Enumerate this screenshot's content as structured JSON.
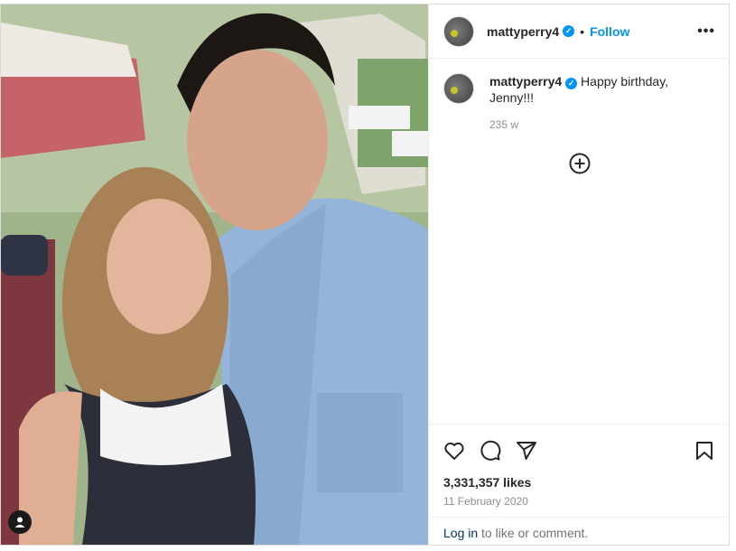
{
  "post": {
    "username": "mattyperry4",
    "verified_mark": "✓",
    "separator": "•",
    "follow_label": "Follow",
    "more_label": "•••",
    "caption_username": "mattyperry4",
    "caption_text": "Happy birthday, Jenny!!!",
    "caption_age": "235 w",
    "likes": "3,331,357 likes",
    "date": "11 February 2020",
    "login_link": "Log in",
    "login_rest": " to like or comment.",
    "icons": [
      "heart-icon",
      "comment-icon",
      "share-icon",
      "bookmark-icon",
      "plus-circle-icon",
      "user-tag-icon"
    ],
    "colors": {
      "accent": "#0095f6",
      "text": "#262626",
      "muted": "#8e8e8e",
      "link": "#00376b"
    }
  }
}
